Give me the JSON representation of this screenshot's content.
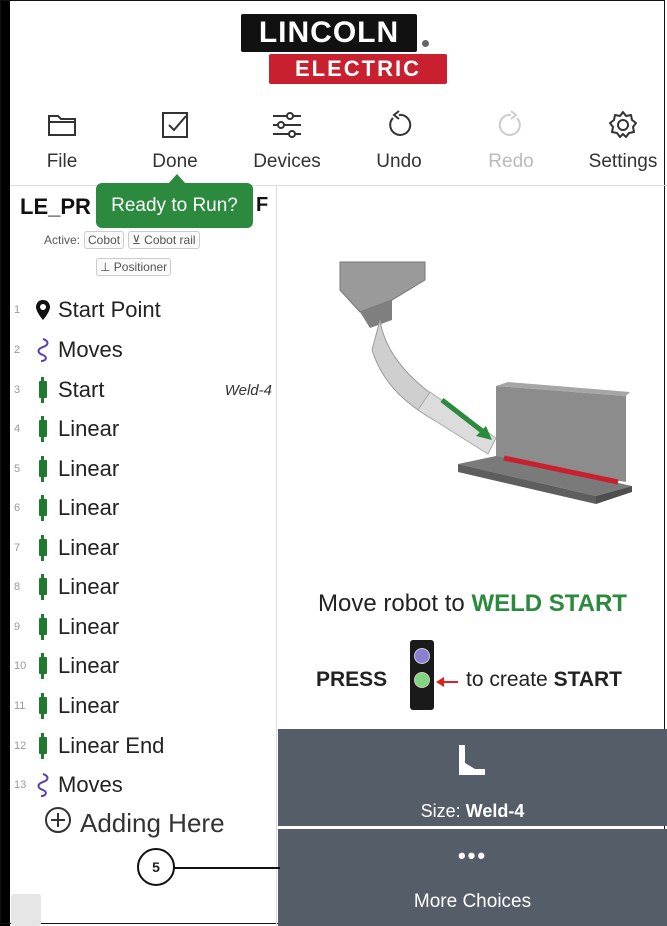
{
  "logo": {
    "top": "LINCOLN",
    "bottom": "ELECTRIC"
  },
  "toolbar": {
    "items": [
      {
        "label": "File",
        "icon": "folder-icon"
      },
      {
        "label": "Done",
        "icon": "checkbox-icon"
      },
      {
        "label": "Devices",
        "icon": "sliders-icon"
      },
      {
        "label": "Undo",
        "icon": "undo-icon"
      },
      {
        "label": "Redo",
        "icon": "redo-icon",
        "disabled": true
      },
      {
        "label": "Settings",
        "icon": "gear-icon"
      }
    ]
  },
  "tooltip": "Ready to Run?",
  "program": {
    "name": "LE_PR",
    "suffix": "F",
    "active_label": "Active:",
    "chips": [
      "Cobot",
      "Cobot rail",
      "Positioner"
    ]
  },
  "steps": [
    {
      "num": "1",
      "label": "Start Point",
      "icon": "location-pin-icon"
    },
    {
      "num": "2",
      "label": "Moves",
      "icon": "moves-squiggle-icon"
    },
    {
      "num": "3",
      "label": "Start",
      "icon": "weld-torch-icon",
      "tag": "Weld-4"
    },
    {
      "num": "4",
      "label": "Linear",
      "icon": "weld-torch-icon"
    },
    {
      "num": "5",
      "label": "Linear",
      "icon": "weld-torch-icon"
    },
    {
      "num": "6",
      "label": "Linear",
      "icon": "weld-torch-icon"
    },
    {
      "num": "7",
      "label": "Linear",
      "icon": "weld-torch-icon"
    },
    {
      "num": "8",
      "label": "Linear",
      "icon": "weld-torch-icon"
    },
    {
      "num": "9",
      "label": "Linear",
      "icon": "weld-torch-icon"
    },
    {
      "num": "10",
      "label": "Linear",
      "icon": "weld-torch-icon"
    },
    {
      "num": "11",
      "label": "Linear",
      "icon": "weld-torch-icon"
    },
    {
      "num": "12",
      "label": "Linear End",
      "icon": "weld-torch-icon"
    },
    {
      "num": "13",
      "label": "Moves",
      "icon": "moves-squiggle-icon"
    }
  ],
  "adding_here": "Adding Here",
  "instruction": {
    "line1_prefix": "Move robot to",
    "line1_highlight": "WELD START",
    "press": "PRESS",
    "to_create": "to create",
    "start": "START"
  },
  "buttons": {
    "size_label": "Size:",
    "size_value": "Weld-4",
    "more_choices": "More Choices"
  },
  "callout": "5",
  "colors": {
    "green": "#2b8a3e",
    "button_bg": "#555e68",
    "brand_red": "#c8202f"
  }
}
